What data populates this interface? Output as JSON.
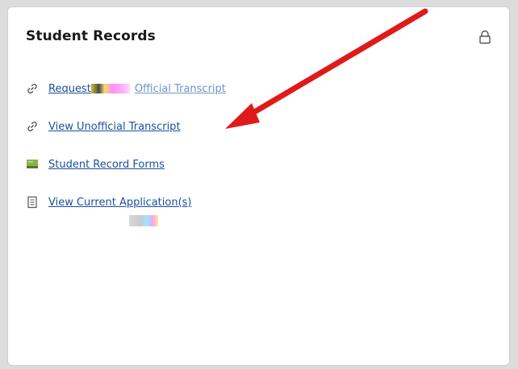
{
  "card": {
    "title": "Student Records"
  },
  "links": [
    {
      "label": "Request",
      "trailing": "Official Transcript",
      "icon": "link-icon"
    },
    {
      "label": "View Unofficial Transcript",
      "icon": "link-icon"
    },
    {
      "label": "Student Record Forms",
      "icon": "book-icon"
    },
    {
      "label": "View Current Application(s)",
      "icon": "document-icon"
    }
  ],
  "colors": {
    "link": "#1b4f9c",
    "annotation_arrow": "#e01919",
    "card_background": "#ffffff"
  },
  "icons": {
    "lock": "lock-icon"
  }
}
